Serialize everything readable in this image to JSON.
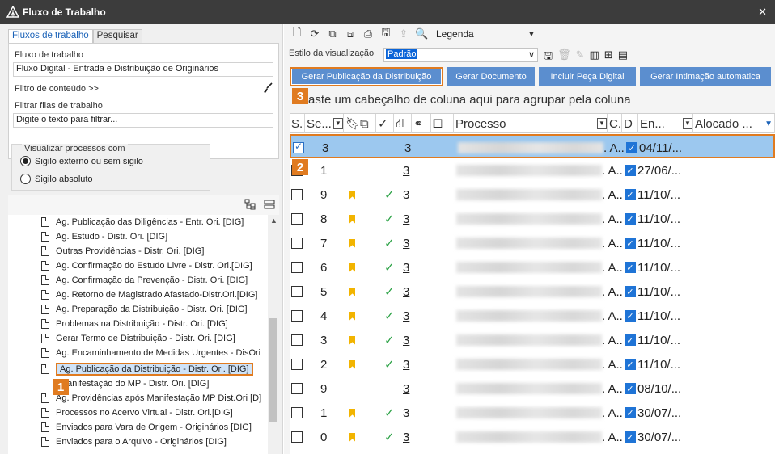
{
  "window": {
    "title": "Fluxo de Trabalho",
    "close_glyph": "✕"
  },
  "left": {
    "tabs": [
      {
        "label": "Fluxos de trabalho",
        "active": true
      },
      {
        "label": "Pesquisar",
        "active": false
      }
    ],
    "workflow_label": "Fluxo de trabalho",
    "workflow_value": "Fluxo Digital - Entrada e Distribuição de Originários",
    "content_filter_label": "Filtro de conteúdo >>",
    "filter_queues_label": "Filtrar filas de trabalho",
    "filter_placeholder": "Digite o texto para filtrar...",
    "visibility_caption": "Visualizar processos com",
    "radio_options": [
      {
        "label": "Sigilo externo ou sem sigilo",
        "checked": true
      },
      {
        "label": "Sigilo absoluto",
        "checked": false
      }
    ],
    "tree_items": [
      "Ag. Publicação das Diligências - Entr. Ori. [DIG]",
      "Ag. Estudo - Distr. Ori. [DIG]",
      "Outras Providências - Distr. Ori. [DIG]",
      "Ag. Confirmação do Estudo Livre - Distr. Ori.[DIG]",
      "Ag. Confirmação da Prevenção - Distr. Ori. [DIG]",
      "Ag. Retorno de Magistrado Afastado-Distr.Ori.[DIG]",
      "Ag. Preparação da Distribuição - Distr. Ori. [DIG]",
      "Problemas na Distribuição - Distr. Ori. [DIG]",
      "Gerar Termo de Distribuição - Distr. Ori. [DIG]",
      "Ag. Encaminhamento de Medidas Urgentes - DisOri",
      "Ag. Publicação da Distribuição - Distr. Ori. [DIG]",
      "Manifestação do MP - Distr. Ori. [DIG]",
      "Ag. Providências após Manifestação MP Dist.Ori [D]",
      "Processos no Acervo Virtual - Distr. Ori.[DIG]",
      "Enviados para Vara de Origem - Originários [DIG]",
      "Enviados para o Arquivo - Originários [DIG]"
    ],
    "selected_index": 10
  },
  "right": {
    "legend_label": "Legenda",
    "style_label": "Estilo da visualização",
    "style_value": "Padrão",
    "action_buttons": [
      "Gerar Publicação da Distribuição",
      "Gerar Documento",
      "Incluir Peça Digital",
      "Gerar Intimação automatica"
    ],
    "group_hint": "aste um cabeçalho de coluna aqui para agrupar pela coluna",
    "columns": {
      "s": "S.",
      "se": "Se...",
      "processo": "Processo",
      "c": "C.",
      "d": "D",
      "en": "En...",
      "alocado": "Alocado ..."
    },
    "rows": [
      {
        "seq": "3",
        "flag": false,
        "check": false,
        "count": "3",
        "c": ". A..",
        "date": "04/11/...",
        "selected": true
      },
      {
        "seq": "1",
        "flag": false,
        "check": false,
        "count": "3",
        "c": ". A..",
        "date": "27/06/...",
        "selected": false
      },
      {
        "seq": "9",
        "flag": true,
        "check": true,
        "count": "3",
        "c": ". A..",
        "date": "11/10/...",
        "selected": false
      },
      {
        "seq": "8",
        "flag": true,
        "check": true,
        "count": "3",
        "c": ". A..",
        "date": "11/10/...",
        "selected": false
      },
      {
        "seq": "7",
        "flag": true,
        "check": true,
        "count": "3",
        "c": ". A..",
        "date": "11/10/...",
        "selected": false
      },
      {
        "seq": "6",
        "flag": true,
        "check": true,
        "count": "3",
        "c": ". A..",
        "date": "11/10/...",
        "selected": false
      },
      {
        "seq": "5",
        "flag": true,
        "check": true,
        "count": "3",
        "c": ". A..",
        "date": "11/10/...",
        "selected": false
      },
      {
        "seq": "4",
        "flag": true,
        "check": true,
        "count": "3",
        "c": ". A..",
        "date": "11/10/...",
        "selected": false
      },
      {
        "seq": "3",
        "flag": true,
        "check": true,
        "count": "3",
        "c": ". A..",
        "date": "11/10/...",
        "selected": false
      },
      {
        "seq": "2",
        "flag": true,
        "check": true,
        "count": "3",
        "c": ". A..",
        "date": "11/10/...",
        "selected": false
      },
      {
        "seq": "9",
        "flag": false,
        "check": false,
        "count": "3",
        "c": ". A..",
        "date": "08/10/...",
        "selected": false
      },
      {
        "seq": "1",
        "flag": true,
        "check": true,
        "count": "3",
        "c": ". A..",
        "date": "30/07/...",
        "selected": false
      },
      {
        "seq": "0",
        "flag": true,
        "check": true,
        "count": "3",
        "c": ". A..",
        "date": "30/07/...",
        "selected": false
      }
    ]
  },
  "badges": [
    "1",
    "2",
    "3"
  ],
  "colors": {
    "titlebar": "#3c3c3c",
    "accent_orange": "#e07b20",
    "button_blue": "#5b8ecf",
    "selection_blue": "#9cc8ef",
    "flag_yellow": "#f2b400",
    "check_green": "#2aa144"
  }
}
